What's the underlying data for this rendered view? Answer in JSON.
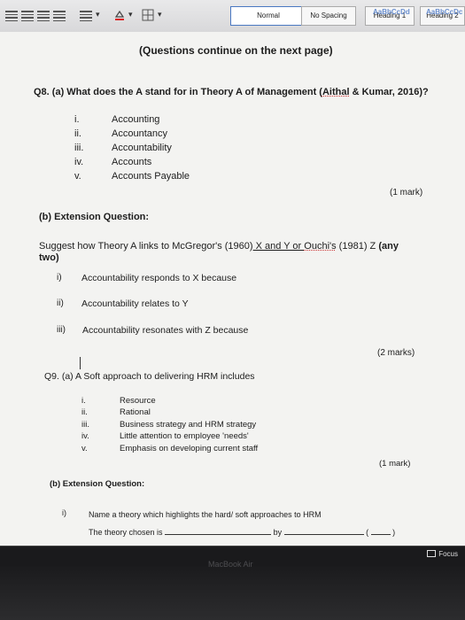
{
  "toolbar": {
    "styles": [
      {
        "label": "Normal",
        "preview": ""
      },
      {
        "label": "No Spacing",
        "preview": ""
      },
      {
        "label": "Heading 1",
        "preview": "AaBbCcDd"
      },
      {
        "label": "Heading 2",
        "preview": "AaBbCcDc"
      }
    ],
    "dropdown_glyph": "▾"
  },
  "document": {
    "continue_note": "(Questions continue on the next page)",
    "q8": {
      "question_a_prefix": "Q8. (a) What does the A stand for in Theory A of Management (",
      "question_a_citation": "Aithal",
      "question_a_suffix": " & Kumar, 2016)?",
      "options": [
        {
          "num": "i.",
          "text": "Accounting"
        },
        {
          "num": "ii.",
          "text": "Accountancy"
        },
        {
          "num": "iii.",
          "text": "Accountability"
        },
        {
          "num": "iv.",
          "text": "Accounts"
        },
        {
          "num": "v.",
          "text": "Accounts Payable"
        }
      ],
      "marks_a": "(1 mark)",
      "extension_title": "(b) Extension Question:",
      "suggest_prefix": "Suggest how Theory A links to McGregor's (1960)",
      "suggest_mid": " X and Y or ",
      "suggest_ouchi": "Ouchi's",
      "suggest_suffix": " (1981) Z ",
      "suggest_bold": "(any",
      "suggest_line2": "two)",
      "points": [
        {
          "num": "i)",
          "text": "Accountability responds to X because"
        },
        {
          "num": "ii)",
          "text": "Accountability relates to Y"
        },
        {
          "num": "iii)",
          "text": "Accountability resonates with Z because"
        }
      ],
      "marks_b": "(2 marks)"
    },
    "q9": {
      "question_a": "Q9. (a) A Soft approach to delivering HRM includes",
      "options": [
        {
          "num": "i.",
          "text": "Resource"
        },
        {
          "num": "ii.",
          "text": "Rational"
        },
        {
          "num": "iii.",
          "text": "Business strategy and HRM strategy"
        },
        {
          "num": "iv.",
          "text": "Little attention to employee 'needs'"
        },
        {
          "num": "v.",
          "text": "Emphasis on developing current staff"
        }
      ],
      "marks_a": "(1 mark)",
      "extension_title": "(b) Extension Question:",
      "point_num": "i)",
      "point_text": "Name a theory which highlights the hard/ soft approaches to HRM",
      "chosen_label": "The theory chosen is",
      "by_label": "by",
      "paren_open": "(",
      "paren_close": ")"
    }
  },
  "statusbar": {
    "focus_label": "Focus"
  },
  "device_label": "MacBook Air"
}
